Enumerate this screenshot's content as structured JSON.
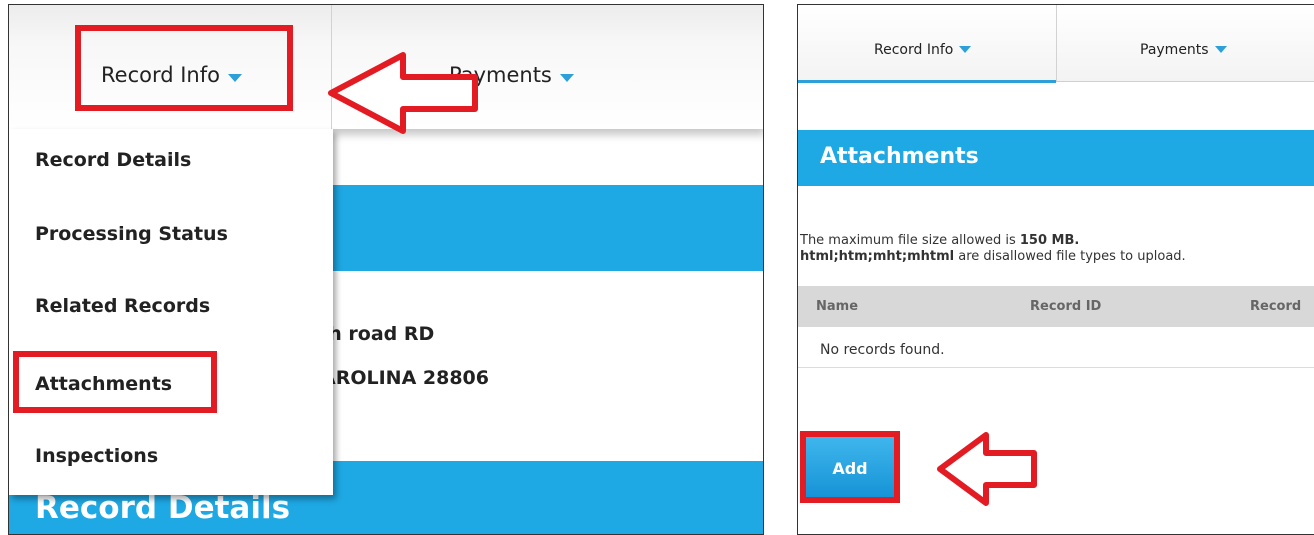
{
  "left": {
    "nav": {
      "tab1_label": "Record Info",
      "tab2_label": "Payments"
    },
    "menu": {
      "items": [
        {
          "label": "Record Details"
        },
        {
          "label": "Processing Status"
        },
        {
          "label": "Related Records"
        },
        {
          "label": "Attachments"
        },
        {
          "label": "Inspections"
        }
      ]
    },
    "address": {
      "line1": "ch road RD",
      "line2": "AROLINA 28806"
    },
    "section_title": "Record Details"
  },
  "right": {
    "nav": {
      "tab1_label": "Record Info",
      "tab2_label": "Payments"
    },
    "attachments_title": "Attachments",
    "info_line1_prefix": "The maximum file size allowed is ",
    "info_line1_size": "150 MB.",
    "info_line2_types": "html;htm;mht;mhtml",
    "info_line2_suffix": " are disallowed file types to upload.",
    "table": {
      "headers": [
        "Name",
        "Record ID",
        "Record"
      ],
      "empty_text": "No records found."
    },
    "add_label": "Add"
  },
  "colors": {
    "accent_blue": "#1ea8e4",
    "highlight_red": "#e31b23",
    "caret_blue": "#2d9fd9"
  }
}
